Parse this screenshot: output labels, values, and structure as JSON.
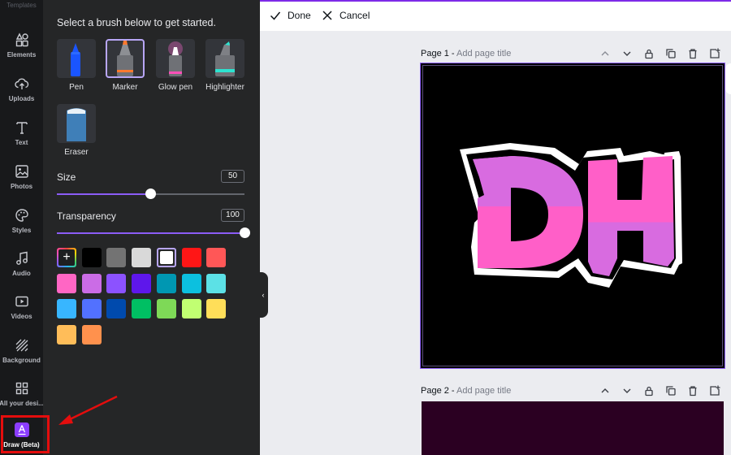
{
  "rail": {
    "top_label": "Templates",
    "items": [
      {
        "label": "Elements",
        "icon": "elements-icon"
      },
      {
        "label": "Uploads",
        "icon": "upload-cloud-icon"
      },
      {
        "label": "Text",
        "icon": "text-icon"
      },
      {
        "label": "Photos",
        "icon": "photo-icon"
      },
      {
        "label": "Styles",
        "icon": "palette-icon"
      },
      {
        "label": "Audio",
        "icon": "music-note-icon"
      },
      {
        "label": "Videos",
        "icon": "video-icon"
      },
      {
        "label": "Background",
        "icon": "background-hatch-icon"
      },
      {
        "label": "All your desi...",
        "icon": "grid-icon"
      },
      {
        "label": "Draw (Beta)",
        "icon": "draw-icon"
      }
    ]
  },
  "draw_panel": {
    "heading": "Select a brush below to get started.",
    "brushes": [
      {
        "label": "Pen",
        "selected": false
      },
      {
        "label": "Marker",
        "selected": true
      },
      {
        "label": "Glow pen",
        "selected": false
      },
      {
        "label": "Highlighter",
        "selected": false
      },
      {
        "label": "Eraser",
        "selected": false
      }
    ],
    "size": {
      "label": "Size",
      "value": "50",
      "fraction": 0.5
    },
    "transparency": {
      "label": "Transparency",
      "value": "100",
      "fraction": 1.0
    },
    "add_color_symbol": "+",
    "colors": [
      "#000000",
      "#737373",
      "#d9d9d9",
      "#ffffff",
      "#ff1616",
      "#ff5757",
      "#ff66c4",
      "#cb6ce6",
      "#8c52ff",
      "#5e17eb",
      "#0097b2",
      "#0cc0df",
      "#5ce1e6",
      "#38b6ff",
      "#5271ff",
      "#004aad",
      "#00bf63",
      "#7ed957",
      "#c1ff72",
      "#ffde59",
      "#ffbd59",
      "#ff914d"
    ],
    "selected_color": "#ffffff"
  },
  "topbar": {
    "done_label": "Done",
    "cancel_label": "Cancel"
  },
  "pages": [
    {
      "number_label": "Page 1 -",
      "title_placeholder": "Add page title",
      "background": "#000000",
      "logo_text": "DH"
    },
    {
      "number_label": "Page 2 -",
      "title_placeholder": "Add page title",
      "background": "#2b0022"
    }
  ],
  "colors": {
    "accent": "#8b5cf6",
    "annotation": "#e40d0d",
    "logo_pink": "#ff5fc8",
    "logo_violet": "#d86be0"
  }
}
